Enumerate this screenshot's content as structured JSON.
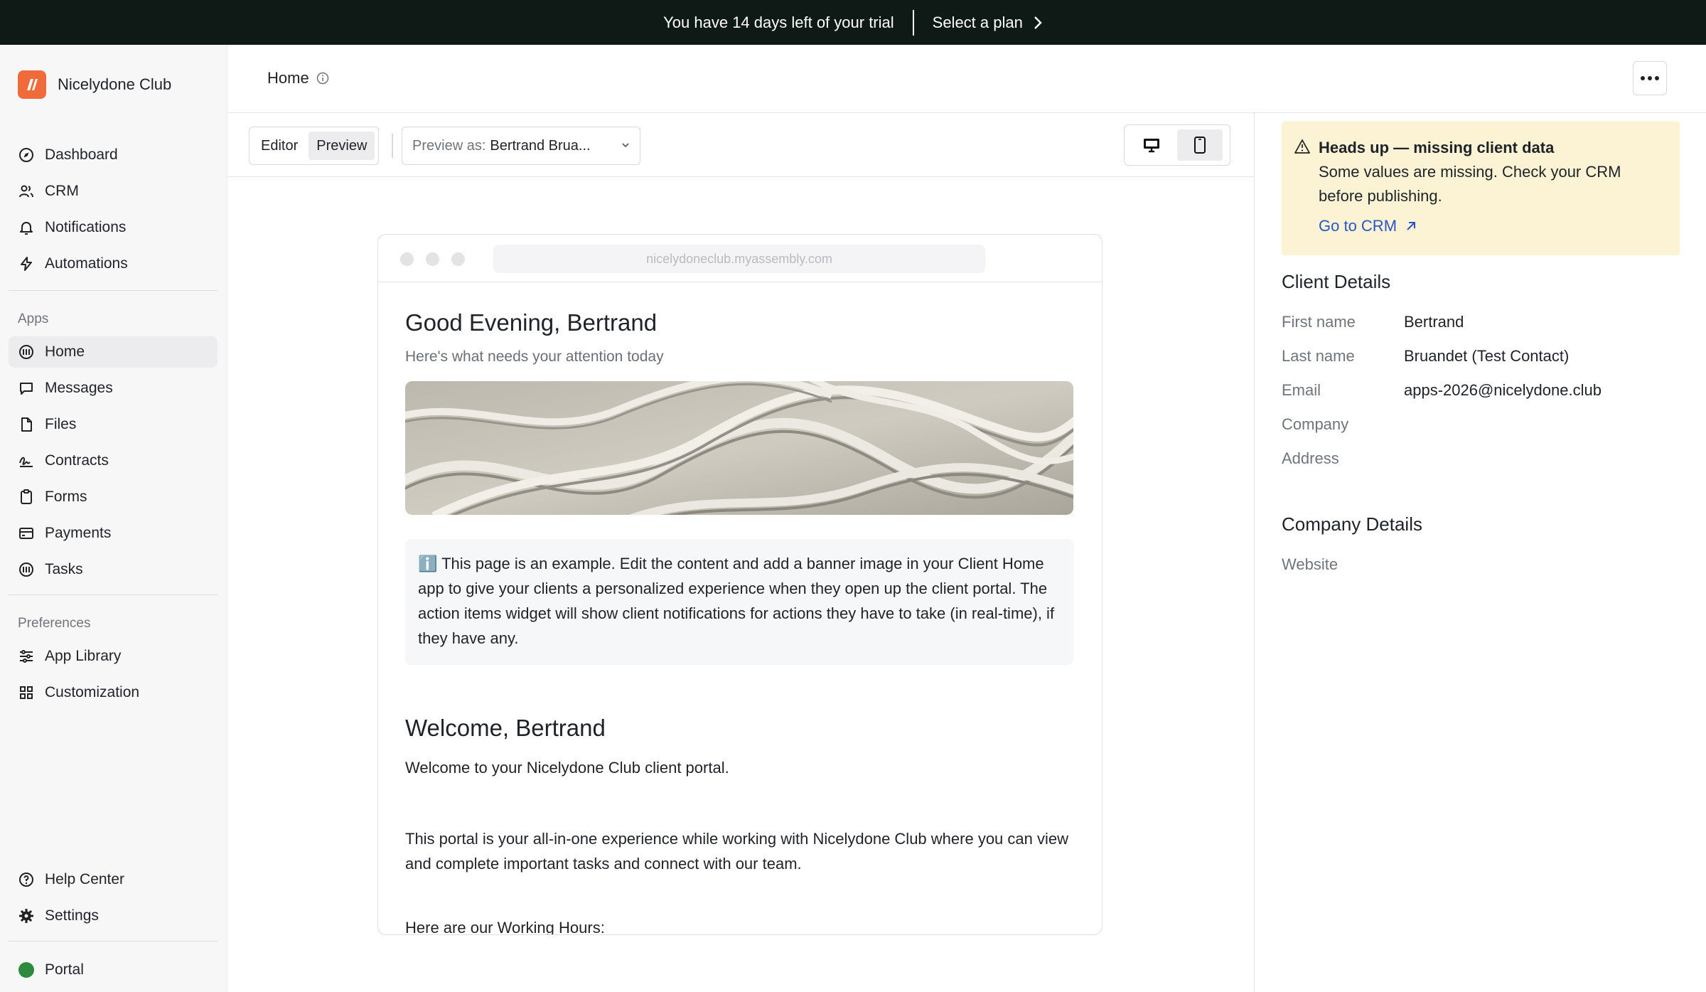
{
  "trial": {
    "message": "You have 14 days left of your trial",
    "cta": "Select a plan"
  },
  "brand": {
    "name": "Nicelydone Club",
    "color": "#f06a3a"
  },
  "nav": {
    "main": [
      {
        "label": "Dashboard",
        "icon": "compass-icon"
      },
      {
        "label": "CRM",
        "icon": "users-icon"
      },
      {
        "label": "Notifications",
        "icon": "bell-icon"
      },
      {
        "label": "Automations",
        "icon": "bolt-icon"
      }
    ],
    "apps_label": "Apps",
    "apps": [
      {
        "label": "Home",
        "icon": "home-app-icon",
        "active": true
      },
      {
        "label": "Messages",
        "icon": "message-icon"
      },
      {
        "label": "Files",
        "icon": "file-icon"
      },
      {
        "label": "Contracts",
        "icon": "signature-icon"
      },
      {
        "label": "Forms",
        "icon": "clipboard-icon"
      },
      {
        "label": "Payments",
        "icon": "card-icon"
      },
      {
        "label": "Tasks",
        "icon": "tasks-icon"
      }
    ],
    "prefs_label": "Preferences",
    "prefs": [
      {
        "label": "App Library",
        "icon": "sliders-icon"
      },
      {
        "label": "Customization",
        "icon": "grid-icon"
      }
    ],
    "bottom": [
      {
        "label": "Help Center",
        "icon": "help-icon"
      },
      {
        "label": "Settings",
        "icon": "gear-icon"
      }
    ],
    "portal": {
      "label": "Portal",
      "status_color": "#2e8b3e"
    }
  },
  "header": {
    "title": "Home"
  },
  "toolbar": {
    "editor": "Editor",
    "preview": "Preview",
    "preview_as_label": "Preview as:",
    "preview_as_value": "Bertrand Brua..."
  },
  "preview": {
    "url": "nicelydoneclub.myassembly.com",
    "greeting": "Good Evening, Bertrand",
    "subtitle": "Here's what needs your attention today",
    "callout": "ℹ️ This page is an example. Edit the content and add a banner image in your Client Home app to give your clients a personalized experience when they open up the client portal. The action items widget will show client notifications for actions they have to take (in real-time), if they have any.",
    "welcome_title": "Welcome, Bertrand",
    "welcome_line": "Welcome to your  Nicelydone Club  client portal.",
    "portal_paragraph": "This portal is your all-in-one experience while working with  Nicelydone Club  where you can view and complete important tasks and connect with our team.",
    "hours_line": "Here are our Working Hours:"
  },
  "alert": {
    "title": "Heads up — missing client data",
    "text": "Some values are missing. Check your CRM before publishing.",
    "link": "Go to CRM"
  },
  "client_details": {
    "title": "Client Details",
    "fields": [
      {
        "key": "First name",
        "value": "Bertrand"
      },
      {
        "key": "Last name",
        "value": "Bruandet (Test Contact)"
      },
      {
        "key": "Email",
        "value": "apps-2026@nicelydone.club"
      },
      {
        "key": "Company",
        "value": ""
      },
      {
        "key": "Address",
        "value": ""
      }
    ]
  },
  "company_details": {
    "title": "Company Details",
    "fields": [
      {
        "key": "Website",
        "value": ""
      }
    ]
  }
}
